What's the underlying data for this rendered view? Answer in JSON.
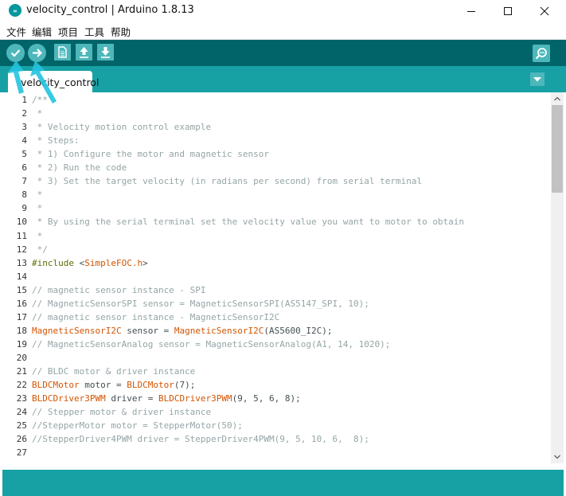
{
  "window": {
    "title": "velocity_control | Arduino 1.8.13",
    "minimize": "minimize",
    "maximize": "maximize",
    "close": "close"
  },
  "menu": {
    "items": [
      "文件",
      "编辑",
      "项目",
      "工具",
      "帮助"
    ]
  },
  "toolbar": {
    "buttons": [
      "verify-icon",
      "upload-icon",
      "new-icon",
      "open-icon",
      "save-icon",
      "serial-monitor-icon"
    ]
  },
  "tabs": [
    {
      "label": "velocity_control",
      "active": true
    }
  ],
  "editor": {
    "lines": [
      "/**",
      " *",
      " * Velocity motion control example",
      " * Steps:",
      " * 1) Configure the motor and magnetic sensor",
      " * 2) Run the code",
      " * 3) Set the target velocity (in radians per second) from serial terminal",
      " *",
      " *",
      " * By using the serial terminal set the velocity value you want to motor to obtain",
      " *",
      " */",
      "#include <SimpleFOC.h>",
      "",
      "// magnetic sensor instance - SPI",
      "// MagneticSensorSPI sensor = MagneticSensorSPI(AS5147_SPI, 10);",
      "// magnetic sensor instance - MagneticSensorI2C",
      "MagneticSensorI2C sensor = MagneticSensorI2C(AS5600_I2C);",
      "// MagneticSensorAnalog sensor = MagneticSensorAnalog(A1, 14, 1020);",
      "",
      "// BLDC motor & driver instance",
      "BLDCMotor motor = BLDCMotor(7);",
      "BLDCDriver3PWM driver = BLDCDriver3PWM(9, 5, 6, 8);",
      "// Stepper motor & driver instance",
      "//StepperMotor motor = StepperMotor(50);",
      "//StepperDriver4PWM driver = StepperDriver4PWM(9, 5, 10, 6,  8);",
      ""
    ]
  },
  "colors": {
    "toolbar": "#006468",
    "tabbar": "#17a1a5",
    "button": "#4db7bb",
    "keyword": "#d35400",
    "comment": "#95a5a6",
    "annotation_arrow": "#22c3e0"
  }
}
